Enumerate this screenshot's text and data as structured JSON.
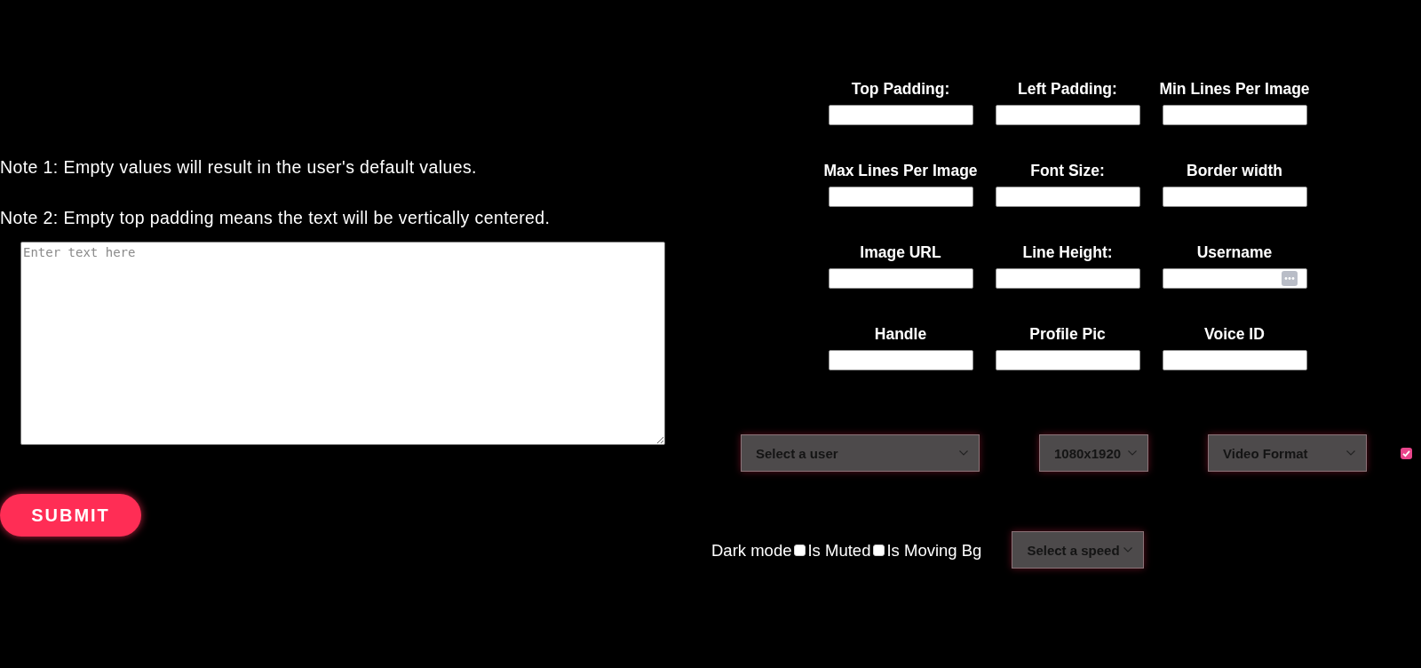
{
  "notes": [
    "Note 1: Empty values will result in the user's default values.",
    "Note 2: Empty top padding means the text will be vertically centered."
  ],
  "text_input": {
    "placeholder": "Enter text here"
  },
  "submit_button": {
    "label": "SUBMIT"
  },
  "settings_fields": [
    {
      "label": "Top Padding:",
      "autofill_button": false
    },
    {
      "label": "Left Padding:",
      "autofill_button": false
    },
    {
      "label": "Min Lines Per Image",
      "autofill_button": false
    },
    {
      "label": "Max Lines Per Image",
      "autofill_button": false
    },
    {
      "label": "Font Size:",
      "autofill_button": false
    },
    {
      "label": "Border width",
      "autofill_button": false
    },
    {
      "label": "Image URL",
      "autofill_button": false
    },
    {
      "label": "Line Height:",
      "autofill_button": false
    },
    {
      "label": "Username",
      "autofill_button": true
    },
    {
      "label": "Handle",
      "autofill_button": false
    },
    {
      "label": "Profile Pic",
      "autofill_button": false
    },
    {
      "label": "Voice ID",
      "autofill_button": false
    }
  ],
  "dropdown_row": {
    "selects": [
      {
        "value": "Select a user"
      },
      {
        "value": "1080x1920"
      },
      {
        "value": "Video Format"
      }
    ],
    "checkbox": {
      "checked": true
    }
  },
  "options_row": {
    "items": [
      {
        "kind": "label",
        "text": "Dark mode"
      },
      {
        "kind": "checkbox",
        "checked": false
      },
      {
        "kind": "label",
        "text": "Is Muted"
      },
      {
        "kind": "checkbox",
        "checked": false
      },
      {
        "kind": "label",
        "text": "Is Moving Bg"
      }
    ],
    "speed_select": {
      "value": "Select a speed"
    }
  }
}
